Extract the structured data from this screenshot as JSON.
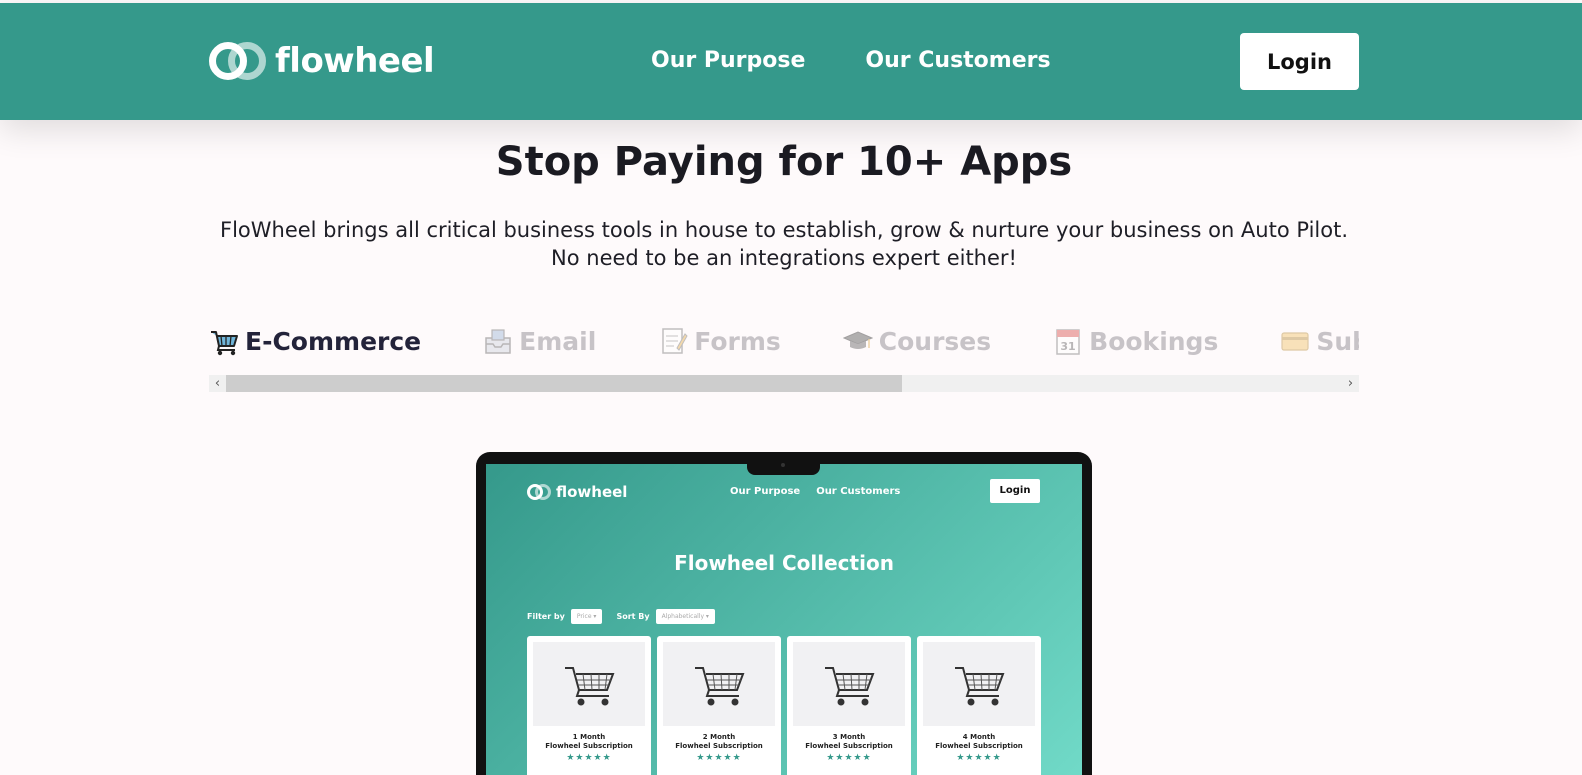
{
  "header": {
    "brand": "flowheel",
    "nav": [
      "Our Purpose",
      "Our Customers"
    ],
    "login_label": "Login"
  },
  "hero": {
    "title": "Stop Paying for 10+ Apps",
    "subtitle": "FloWheel brings all critical business tools in house to establish, grow & nurture your business on Auto Pilot. No need to be an integrations expert either!"
  },
  "tabs": [
    {
      "label": "E-Commerce",
      "icon": "shopping-cart-icon",
      "active": true
    },
    {
      "label": "Email",
      "icon": "inbox-tray-icon",
      "active": false
    },
    {
      "label": "Forms",
      "icon": "memo-icon",
      "active": false
    },
    {
      "label": "Courses",
      "icon": "graduation-cap-icon",
      "active": false
    },
    {
      "label": "Bookings",
      "icon": "calendar-icon",
      "active": false
    },
    {
      "label": "Subscriptions",
      "icon": "credit-card-icon",
      "active": false
    }
  ],
  "calendar_day": "31",
  "mockup": {
    "brand": "flowheel",
    "nav": [
      "Our Purpose",
      "Our Customers"
    ],
    "login_label": "Login",
    "title": "Flowheel Collection",
    "filter_label": "Filter by",
    "filter_value": "Price",
    "sort_label": "Sort By",
    "sort_value": "Alphabetically",
    "products": [
      {
        "duration": "1 Month",
        "name": "Flowheel Subscription",
        "rating": "★★★★★"
      },
      {
        "duration": "2 Month",
        "name": "Flowheel Subscription",
        "rating": "★★★★★"
      },
      {
        "duration": "3 Month",
        "name": "Flowheel Subscription",
        "rating": "★★★★★"
      },
      {
        "duration": "4 Month",
        "name": "Flowheel Subscription",
        "rating": "★★★★★"
      }
    ]
  },
  "colors": {
    "brand_teal": "#35998b",
    "teal_light": "#72dbc9",
    "page_bg": "#fefafb"
  }
}
